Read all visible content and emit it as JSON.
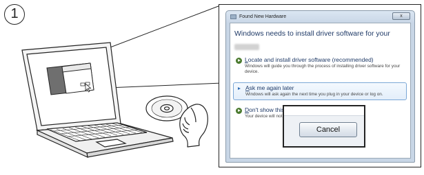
{
  "step": {
    "number": "1"
  },
  "dialog": {
    "title": "Found New Hardware",
    "close_label": "x",
    "heading": "Windows needs to install driver software for your",
    "options": [
      {
        "accel": "L",
        "title_rest": "ocate and install driver software (recommended)",
        "desc": "Windows will guide you through the process of installing driver software for your device."
      },
      {
        "accel": "A",
        "title_rest": "sk me again later",
        "desc": "Windows will ask again the next time you plug in your device or log on."
      },
      {
        "accel": "D",
        "title_rest": "on't show this message again for this device",
        "desc": "Your device will not function until you install driver so"
      }
    ],
    "selected_option": 1
  },
  "cancel_button": {
    "label": "Cancel"
  },
  "colors": {
    "outline": "#222222",
    "heading_text": "#1e3966",
    "option_icon": "#4a7a2e",
    "selection_border": "#7aa7d6"
  },
  "icons": [
    "circled-step-number",
    "laptop-icon",
    "cd-disc-icon",
    "hand-icon",
    "arrow-icon",
    "mouse-cursor-icon"
  ]
}
